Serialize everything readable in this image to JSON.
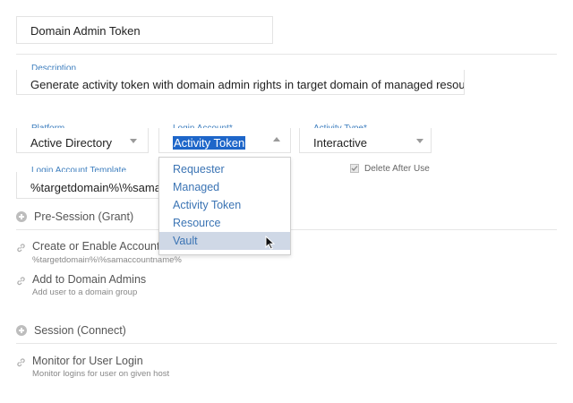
{
  "name_field": {
    "value": "Domain Admin Token"
  },
  "description": {
    "label": "Description",
    "value": "Generate activity token with domain admin rights in target domain of managed resource"
  },
  "platform": {
    "label": "Platform",
    "value": "Active Directory"
  },
  "login_account": {
    "label": "Login Account*",
    "value": "Activity Token",
    "options": [
      "Requester",
      "Managed",
      "Activity Token",
      "Resource",
      "Vault"
    ],
    "hovered_option": "Vault"
  },
  "activity_type": {
    "label": "Activity Type*",
    "value": "Interactive"
  },
  "login_account_template": {
    "label": "Login Account Template",
    "value": "%targetdomain%\\%samacc"
  },
  "delete_after_use": {
    "label": "Delete After Use",
    "checked": true
  },
  "pre_session": {
    "title": "Pre-Session (Grant)",
    "steps": [
      {
        "title": "Create or Enable Account",
        "subtitle": "%targetdomain%\\%samaccountname%"
      },
      {
        "title": "Add to Domain Admins",
        "subtitle": "Add user to a domain group"
      }
    ]
  },
  "session": {
    "title": "Session (Connect)",
    "steps": [
      {
        "title": "Monitor for User Login",
        "subtitle": "Monitor logins for user on given host"
      }
    ]
  },
  "icons": {
    "section_expand": "plus-circle-icon",
    "step": "link-icon",
    "dropdown": "chevron-down-icon",
    "cursor": "mouse-pointer-icon"
  },
  "colors": {
    "label_blue": "#3f7fbf",
    "selection_blue": "#1e66c9",
    "option_text": "#3b74b4",
    "hover_bg": "#cfd8e6"
  }
}
